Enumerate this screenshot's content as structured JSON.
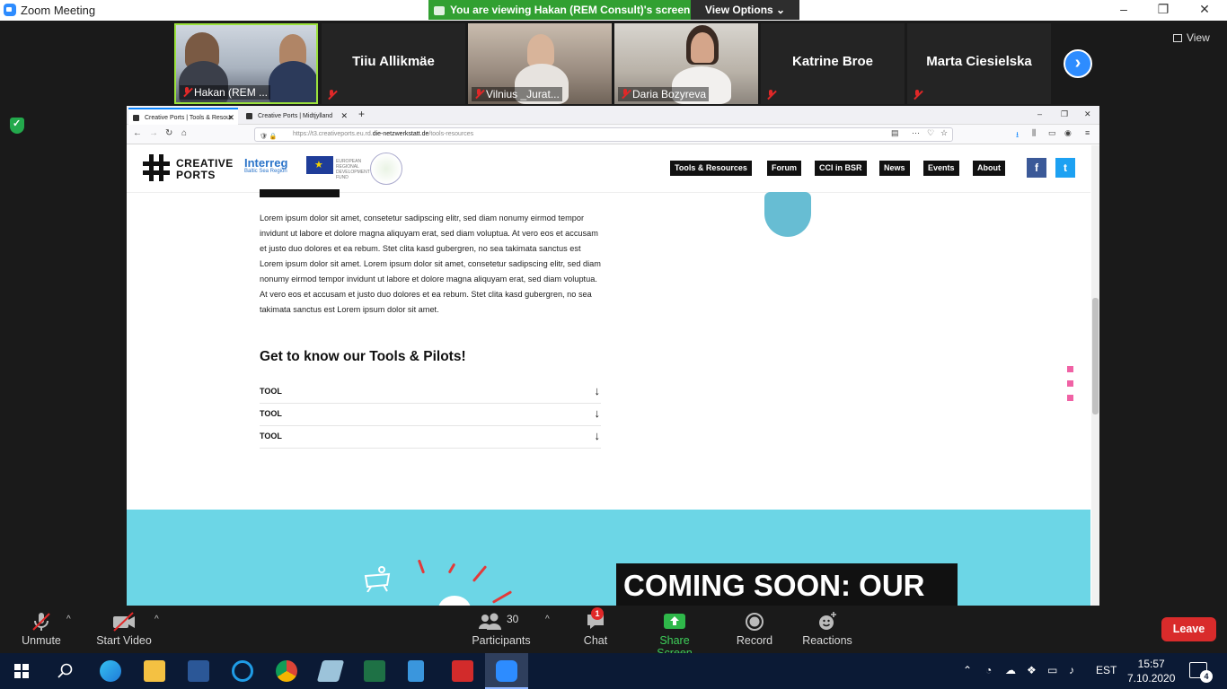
{
  "zoom": {
    "window_title": "Zoom Meeting",
    "viewing_banner": "You are viewing Hakan (REM Consult)'s screen",
    "view_options": "View Options ⌄",
    "win_min": "–",
    "win_max": "❐",
    "win_close": "✕",
    "view_label": "View",
    "participants_tiles": [
      {
        "label": "Hakan (REM ..."
      },
      {
        "label": "Tiiu Allikmäe"
      },
      {
        "label": "Vilnius _Jurat..."
      },
      {
        "label": "Daria Bozyreva"
      },
      {
        "label": "Katrine Broe"
      },
      {
        "label": "Marta Ciesielska"
      }
    ],
    "toolbar": {
      "unmute": "Unmute",
      "start_video": "Start Video",
      "participants": "Participants",
      "participants_count": "30",
      "chat": "Chat",
      "chat_badge": "1",
      "share_screen": "Share Screen",
      "record": "Record",
      "reactions": "Reactions",
      "leave": "Leave"
    }
  },
  "browser": {
    "tabs": [
      {
        "title": "Creative Ports | Tools & Resour",
        "close": "✕"
      },
      {
        "title": "Creative Ports | Midtjylland",
        "close": "✕"
      }
    ],
    "new_tab": "+",
    "url_prefix": "https://t3.creativeports.eu.rd.",
    "url_domain": "die-netzwerkstatt.de",
    "url_path": "/tools-resources"
  },
  "site": {
    "logo_text_line1": "CREATIVE",
    "logo_text_line2": "PORTS",
    "interreg": "Interreg",
    "interreg_sub": "Baltic Sea Region",
    "eu_text": "EUROPEAN REGIONAL DEVELOPMENT FUND",
    "nav": [
      "Tools & Resources",
      "Forum",
      "CCI in BSR",
      "News",
      "Events",
      "About"
    ],
    "social_facebook": "f",
    "social_twitter": "t",
    "body_text": "Lorem ipsum dolor sit amet, consetetur sadipscing elitr, sed diam nonumy eirmod tempor invidunt ut labore et dolore magna aliquyam erat, sed diam voluptua. At vero eos et accusam et justo duo dolores et ea rebum. Stet clita kasd gubergren, no sea takimata sanctus est Lorem ipsum dolor sit amet. Lorem ipsum dolor sit amet, consetetur sadipscing elitr, sed diam nonumy eirmod tempor invidunt ut labore et dolore magna aliquyam erat, sed diam voluptua. At vero eos et accusam et justo duo dolores et ea rebum. Stet clita kasd gubergren, no sea takimata sanctus est Lorem ipsum dolor sit amet.",
    "tools_heading": "Get to know our Tools & Pilots!",
    "tools": [
      "TOOL",
      "TOOL",
      "TOOL"
    ],
    "coming_soon": "COMING SOON: OUR"
  },
  "taskbar": {
    "language": "EST",
    "time": "15:57",
    "date": "7.10.2020",
    "notifications": "4"
  },
  "colors": {
    "zoom_green": "#31a031",
    "zoom_blue": "#2d8cff",
    "leave_red": "#d92b2b",
    "site_cyan": "#6cd6e6",
    "site_pink": "#f062a5"
  }
}
